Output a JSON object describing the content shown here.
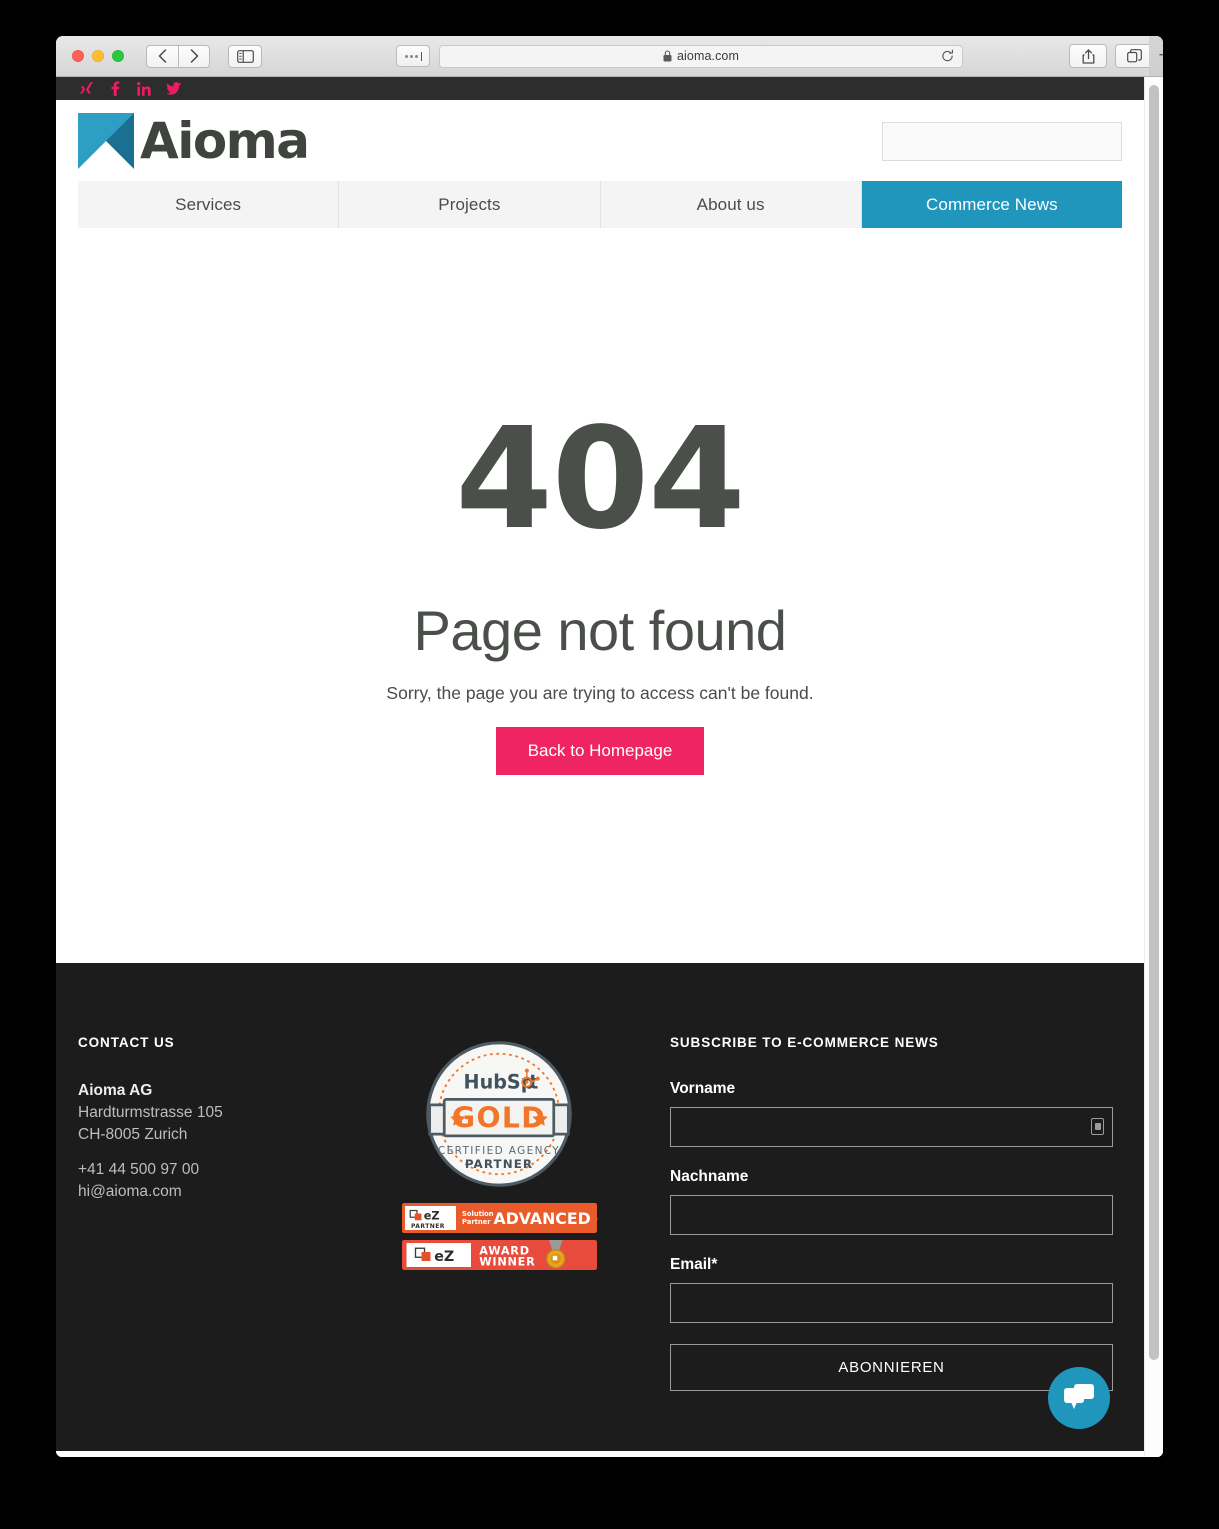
{
  "browser": {
    "url": "aioma.com",
    "lock_icon": "lock-icon",
    "back_icon": "chevron-left-icon",
    "forward_icon": "chevron-right-icon",
    "sidebar_icon": "sidebar-toggle-icon",
    "extensions_icon": "ellipsis-icon",
    "reload_icon": "reload-icon",
    "share_icon": "share-icon",
    "tabs_icon": "tab-overview-icon",
    "new_tab_label": "+"
  },
  "topbar": {
    "socials": [
      {
        "name": "xing-icon",
        "label": "Xing"
      },
      {
        "name": "facebook-icon",
        "label": "Facebook"
      },
      {
        "name": "linkedin-icon",
        "label": "LinkedIn"
      },
      {
        "name": "twitter-icon",
        "label": "Twitter"
      }
    ],
    "accent_color": "#ec1c5f",
    "background": "#2d2d2d"
  },
  "header": {
    "logo_text": "Aioma",
    "logo_color": "#2196bd",
    "search_value": "",
    "search_placeholder": ""
  },
  "nav": {
    "active_color": "#2196bd",
    "items": [
      {
        "label": "Services",
        "active": false
      },
      {
        "label": "Projects",
        "active": false
      },
      {
        "label": "About us",
        "active": false
      },
      {
        "label": "Commerce News",
        "active": true
      }
    ]
  },
  "main": {
    "error_code": "404",
    "headline": "Page not found",
    "subtext": "Sorry, the page you are trying to access can't be found.",
    "cta_label": "Back to Homepage",
    "cta_color": "#ee2560"
  },
  "footer": {
    "contact": {
      "title": "CONTACT US",
      "company": "Aioma AG",
      "street": "Hardturmstrasse 105",
      "city": "CH-8005 Zurich",
      "phone": "+41 44 500 97 00",
      "email": "hi@aioma.com"
    },
    "badges": [
      {
        "name": "hubspot-gold-partner-badge",
        "brand": "HubSpot",
        "tier": "GOLD",
        "line1": "CERTIFIED AGENCY",
        "line2": "PARTNER"
      },
      {
        "name": "ez-solution-partner-advanced-badge",
        "mark": "eZ",
        "mark_sub": "PARTNER",
        "pre1": "Solution",
        "pre2": "Partner",
        "text": "ADVANCED +"
      },
      {
        "name": "ez-award-winner-badge",
        "mark": "eZ",
        "line1": "AWARD",
        "line2": "WINNER"
      }
    ],
    "subscribe": {
      "title": "SUBSCRIBE TO E-COMMERCE NEWS",
      "fields": [
        {
          "label": "Vorname",
          "value": "",
          "autofill": true
        },
        {
          "label": "Nachname",
          "value": "",
          "autofill": false
        },
        {
          "label": "Email*",
          "value": "",
          "autofill": false
        }
      ],
      "button_label": "ABONNIEREN"
    },
    "background": "#1c1c1c"
  },
  "chat": {
    "name": "chat-bubble-icon",
    "color": "#2196bd"
  }
}
